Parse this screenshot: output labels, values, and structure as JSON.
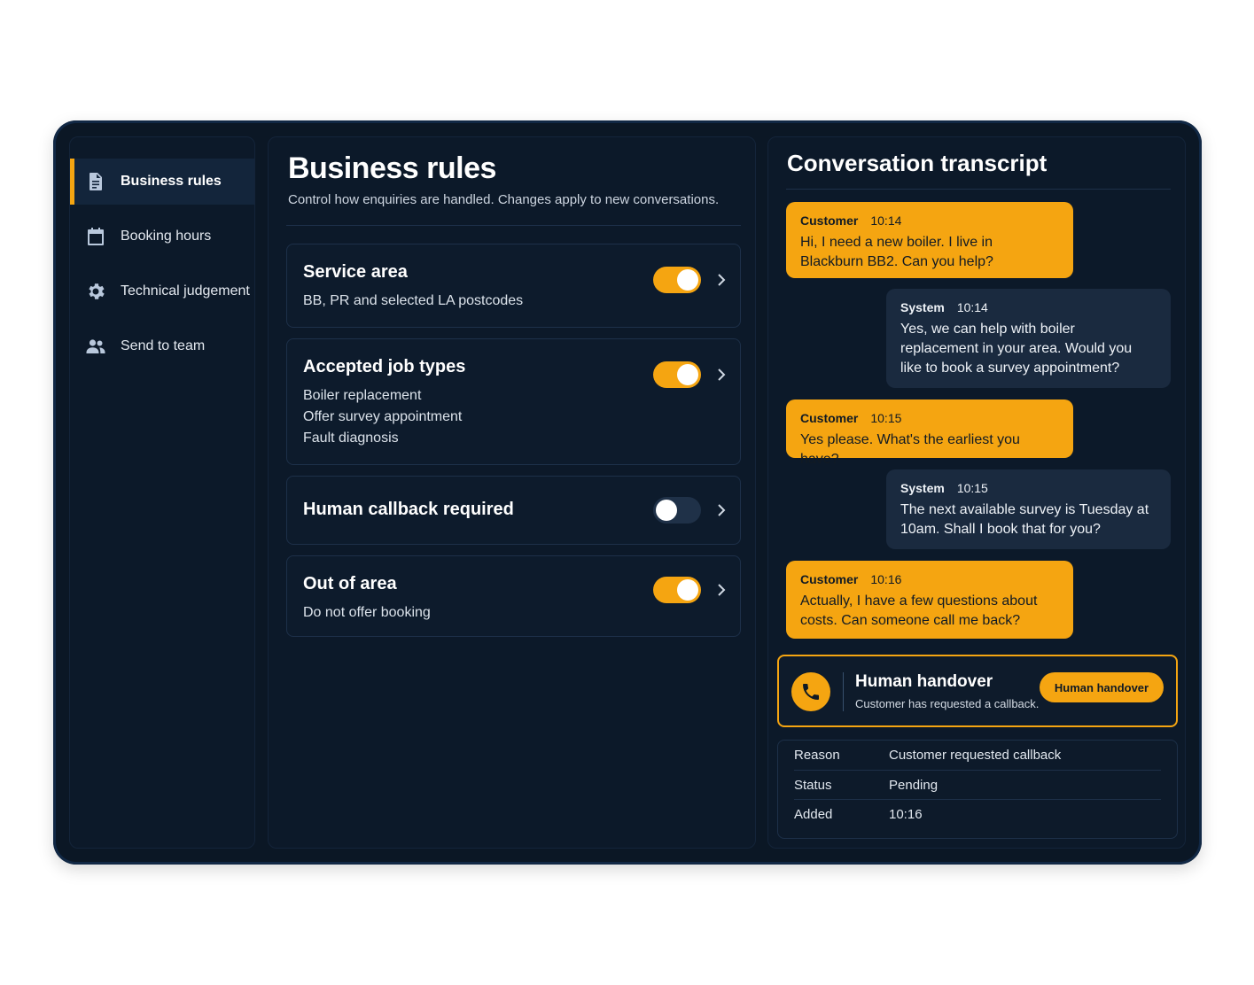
{
  "sidebar": {
    "items": [
      {
        "label": "Business rules",
        "icon": "document-icon",
        "active": true
      },
      {
        "label": "Booking hours",
        "icon": "calendar-icon",
        "active": false
      },
      {
        "label": "Technical judgement",
        "icon": "gear-icon",
        "active": false
      },
      {
        "label": "Send to team",
        "icon": "team-icon",
        "active": false
      }
    ]
  },
  "main": {
    "title": "Business rules",
    "subtitle": "Control how enquiries are handled. Changes apply to new conversations.",
    "rules": [
      {
        "title": "Service area",
        "lines": [
          "BB, PR and selected LA postcodes"
        ],
        "enabled": true
      },
      {
        "title": "Accepted job types",
        "lines": [
          "Boiler replacement",
          "Offer survey appointment",
          "Fault diagnosis"
        ],
        "enabled": true
      },
      {
        "title": "Human callback required",
        "lines": [],
        "enabled": false
      },
      {
        "title": "Out of area",
        "lines": [
          "Do not offer booking"
        ],
        "enabled": true
      }
    ]
  },
  "transcript": {
    "title": "Conversation transcript",
    "messages": [
      {
        "sender": "Customer",
        "time": "10:14",
        "text": "Hi, I need a new boiler. I live in Blackburn BB2. Can you help?"
      },
      {
        "sender": "System",
        "time": "10:14",
        "text": "Yes, we can help with boiler replacement in your area. Would you like to book a survey appointment?"
      },
      {
        "sender": "Customer",
        "time": "10:15",
        "text": "Yes please. What's the earliest you have?"
      },
      {
        "sender": "System",
        "time": "10:15",
        "text": "The next available survey is Tuesday at 10am. Shall I book that for you?"
      },
      {
        "sender": "Customer",
        "time": "10:16",
        "text": "Actually, I have a few questions about costs. Can someone call me back?"
      }
    ],
    "handover": {
      "title": "Human handover",
      "subtitle": "Customer has requested a callback.",
      "button_label": "Human handover",
      "icon": "phone-icon"
    },
    "details": [
      {
        "key": "Reason",
        "value": "Customer requested callback"
      },
      {
        "key": "Status",
        "value": "Pending"
      },
      {
        "key": "Added",
        "value": "10:16"
      }
    ]
  },
  "colors": {
    "accent": "#f5a511",
    "background": "#0b1725",
    "system_bubble": "#1a2a3f"
  }
}
